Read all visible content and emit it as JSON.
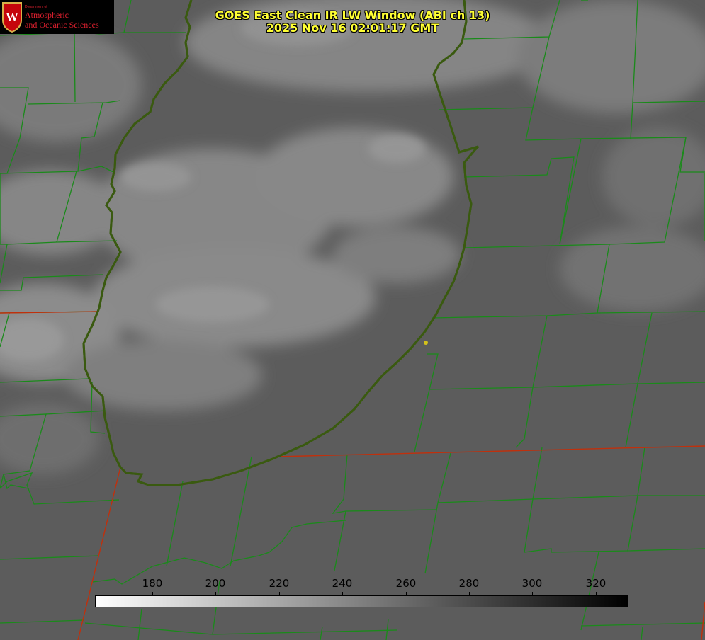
{
  "title": {
    "line1": "GOES East Clean IR LW Window (ABI ch 13)",
    "line2": "2025 Nov 16 02:01:17 GMT"
  },
  "logo": {
    "department": "Department of",
    "name_line1": "Atmospheric",
    "name_line2": "and Oceanic Sciences",
    "crest_letter": "W"
  },
  "colorbar": {
    "ticks": [
      "180",
      "200",
      "220",
      "240",
      "260",
      "280",
      "300",
      "320"
    ],
    "gradient_start": "#ffffff",
    "gradient_end": "#000000"
  },
  "colors": {
    "county_lines": "#1a8a1a",
    "coastline": "#e01010",
    "title_text": "#ffff33",
    "marker": "#d4c21a",
    "land_gray": "#5a5a5a"
  },
  "legend": {
    "marker_icon": "location-dot-icon"
  }
}
